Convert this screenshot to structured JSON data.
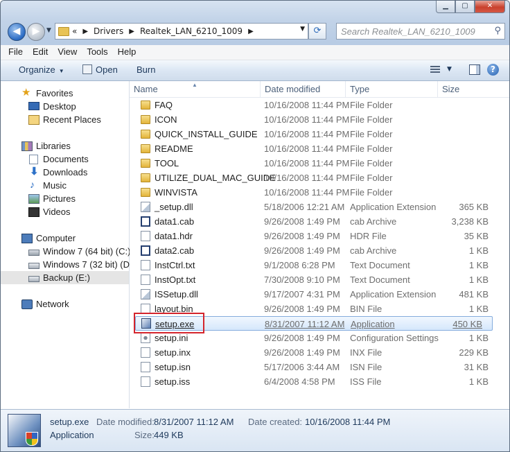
{
  "window": {
    "controls": {
      "minimize": "▁",
      "maximize": "▢",
      "close": "✕"
    }
  },
  "address_bar": {
    "prefix": "«",
    "path": [
      "Drivers",
      "Realtek_LAN_6210_1009"
    ]
  },
  "search": {
    "placeholder": "Search Realtek_LAN_6210_1009"
  },
  "menu": {
    "items": [
      "File",
      "Edit",
      "View",
      "Tools",
      "Help"
    ]
  },
  "toolbar": {
    "organize": "Organize",
    "open": "Open",
    "burn": "Burn"
  },
  "nav_pane": {
    "favorites": {
      "label": "Favorites",
      "items": [
        "Desktop",
        "Recent Places"
      ]
    },
    "libraries": {
      "label": "Libraries",
      "items": [
        "Documents",
        "Downloads",
        "Music",
        "Pictures",
        "Videos"
      ]
    },
    "computer": {
      "label": "Computer",
      "items": [
        "Window 7 (64 bit) (C:)",
        "Windows 7 (32 bit) (D:)",
        "Backup (E:)"
      ]
    },
    "network": {
      "label": "Network"
    }
  },
  "columns": {
    "name": "Name",
    "date": "Date modified",
    "type": "Type",
    "size": "Size"
  },
  "files": [
    {
      "name": "FAQ",
      "date": "10/16/2008 11:44 PM",
      "type": "File Folder",
      "size": "",
      "icon": "folder"
    },
    {
      "name": "ICON",
      "date": "10/16/2008 11:44 PM",
      "type": "File Folder",
      "size": "",
      "icon": "folder"
    },
    {
      "name": "QUICK_INSTALL_GUIDE",
      "date": "10/16/2008 11:44 PM",
      "type": "File Folder",
      "size": "",
      "icon": "folder"
    },
    {
      "name": "README",
      "date": "10/16/2008 11:44 PM",
      "type": "File Folder",
      "size": "",
      "icon": "folder"
    },
    {
      "name": "TOOL",
      "date": "10/16/2008 11:44 PM",
      "type": "File Folder",
      "size": "",
      "icon": "folder"
    },
    {
      "name": "UTILIZE_DUAL_MAC_GUIDE",
      "date": "10/16/2008 11:44 PM",
      "type": "File Folder",
      "size": "",
      "icon": "folder"
    },
    {
      "name": "WINVISTA",
      "date": "10/16/2008 11:44 PM",
      "type": "File Folder",
      "size": "",
      "icon": "folder"
    },
    {
      "name": "_setup.dll",
      "date": "5/18/2006 12:21 AM",
      "type": "Application Extension",
      "size": "365 KB",
      "icon": "dll"
    },
    {
      "name": "data1.cab",
      "date": "9/26/2008 1:49 PM",
      "type": "cab Archive",
      "size": "3,238 KB",
      "icon": "cab"
    },
    {
      "name": "data1.hdr",
      "date": "9/26/2008 1:49 PM",
      "type": "HDR File",
      "size": "35 KB",
      "icon": "doc"
    },
    {
      "name": "data2.cab",
      "date": "9/26/2008 1:49 PM",
      "type": "cab Archive",
      "size": "1 KB",
      "icon": "cab"
    },
    {
      "name": "InstCtrl.txt",
      "date": "9/1/2008 6:28 PM",
      "type": "Text Document",
      "size": "1 KB",
      "icon": "doc"
    },
    {
      "name": "InstOpt.txt",
      "date": "7/30/2008 9:10 PM",
      "type": "Text Document",
      "size": "1 KB",
      "icon": "doc"
    },
    {
      "name": "ISSetup.dll",
      "date": "9/17/2007 4:31 PM",
      "type": "Application Extension",
      "size": "481 KB",
      "icon": "dll"
    },
    {
      "name": "layout.bin",
      "date": "9/26/2008 1:49 PM",
      "type": "BIN File",
      "size": "1 KB",
      "icon": "doc"
    },
    {
      "name": "setup.exe",
      "date": "8/31/2007 11:12 AM",
      "type": "Application",
      "size": "450 KB",
      "icon": "exe",
      "selected": true
    },
    {
      "name": "setup.ini",
      "date": "9/26/2008 1:49 PM",
      "type": "Configuration Settings",
      "size": "1 KB",
      "icon": "ini"
    },
    {
      "name": "setup.inx",
      "date": "9/26/2008 1:49 PM",
      "type": "INX File",
      "size": "229 KB",
      "icon": "doc"
    },
    {
      "name": "setup.isn",
      "date": "5/17/2006 3:44 AM",
      "type": "ISN File",
      "size": "31 KB",
      "icon": "doc"
    },
    {
      "name": "setup.iss",
      "date": "6/4/2008 4:58 PM",
      "type": "ISS File",
      "size": "1 KB",
      "icon": "doc"
    }
  ],
  "details": {
    "filename": "setup.exe",
    "filetype": "Application",
    "date_modified_label": "Date modified:",
    "date_modified": "8/31/2007 11:12 AM",
    "date_created_label": "Date created:",
    "date_created": "10/16/2008 11:44 PM",
    "size_label": "Size:",
    "size": "449 KB"
  },
  "colors": {
    "highlight_box": "#d4242c",
    "selection": "#d5e7fc"
  }
}
